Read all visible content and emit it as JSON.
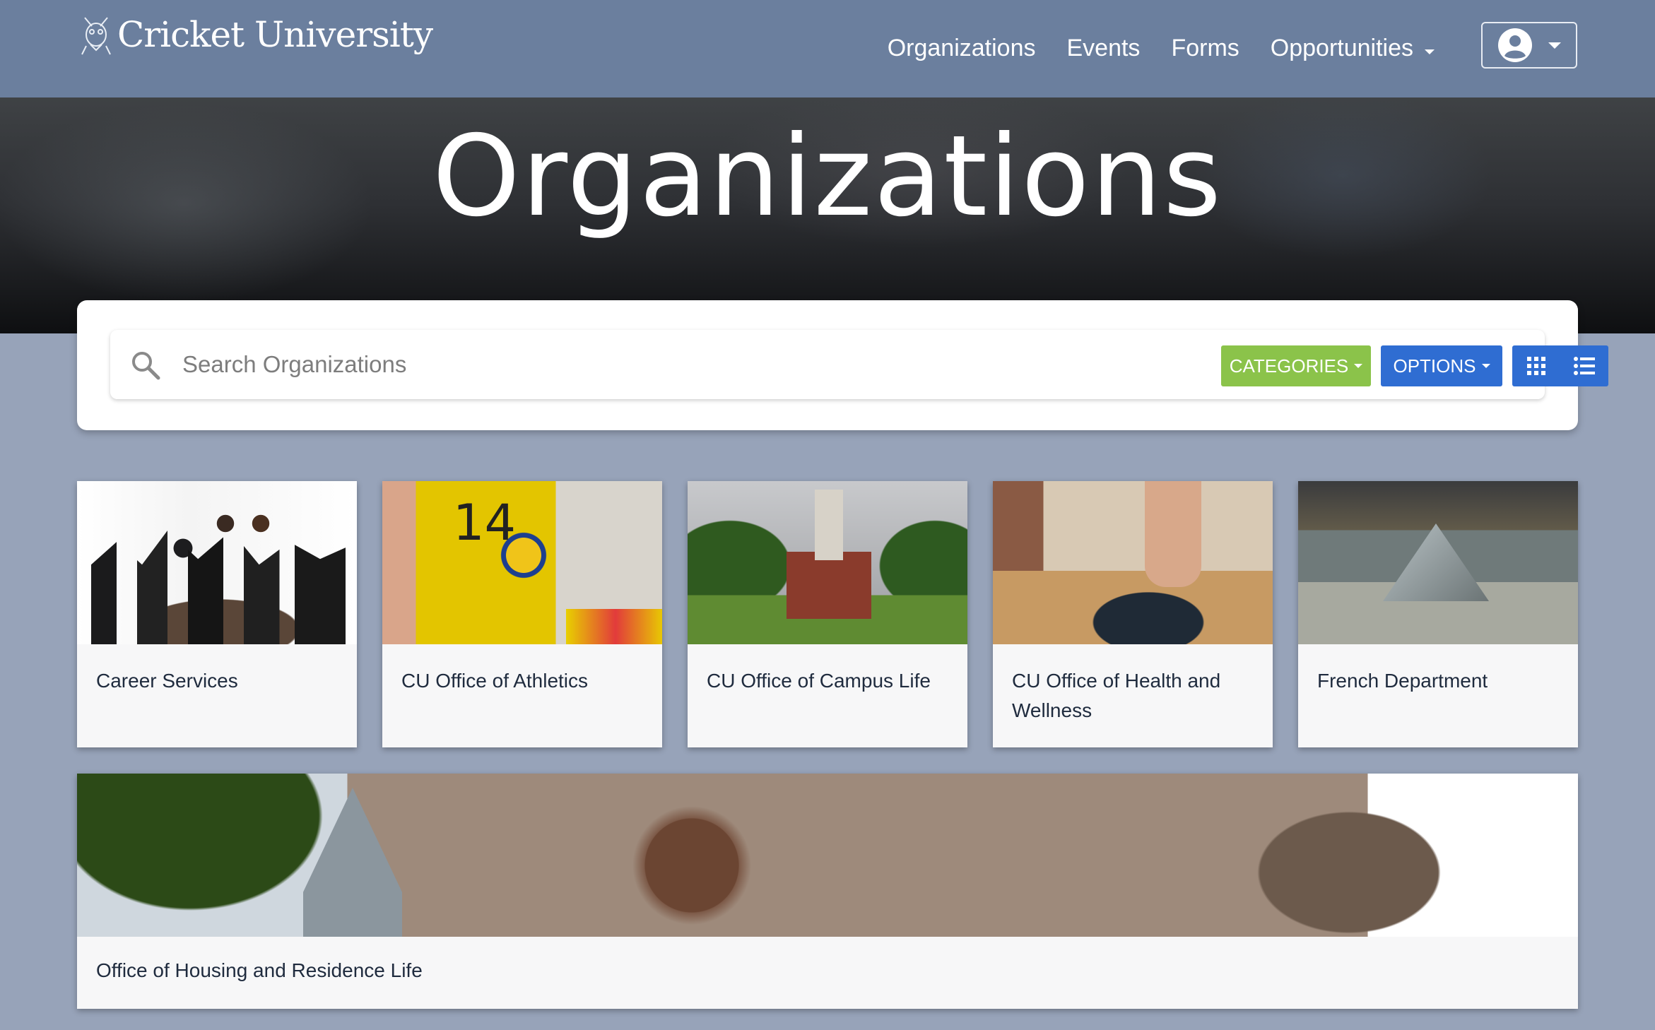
{
  "brand": {
    "name": "Cricket University",
    "logo_icon": "cricket-logo-icon"
  },
  "nav": {
    "links": [
      {
        "label": "Organizations"
      },
      {
        "label": "Events"
      },
      {
        "label": "Forms"
      },
      {
        "label": "Opportunities",
        "has_dropdown": true
      }
    ],
    "user_menu_icon": "user-circle-icon"
  },
  "hero": {
    "title": "Organizations"
  },
  "search": {
    "placeholder": "Search Organizations",
    "value": "",
    "categories_label": "CATEGORIES",
    "options_label": "OPTIONS",
    "view_toggle_icons": [
      "grid-icon",
      "list-icon"
    ]
  },
  "colors": {
    "navbar": "#6b7f9e",
    "page_background": "#97a3b9",
    "categories_button": "#8bc34a",
    "options_button": "#2f6dd2"
  },
  "organizations": [
    {
      "name": "Career Services"
    },
    {
      "name": "CU Office of Athletics"
    },
    {
      "name": "CU Office of Campus Life"
    },
    {
      "name": "CU Office of Health and Wellness"
    },
    {
      "name": "French Department"
    },
    {
      "name": "Office of Housing and Residence Life"
    }
  ]
}
